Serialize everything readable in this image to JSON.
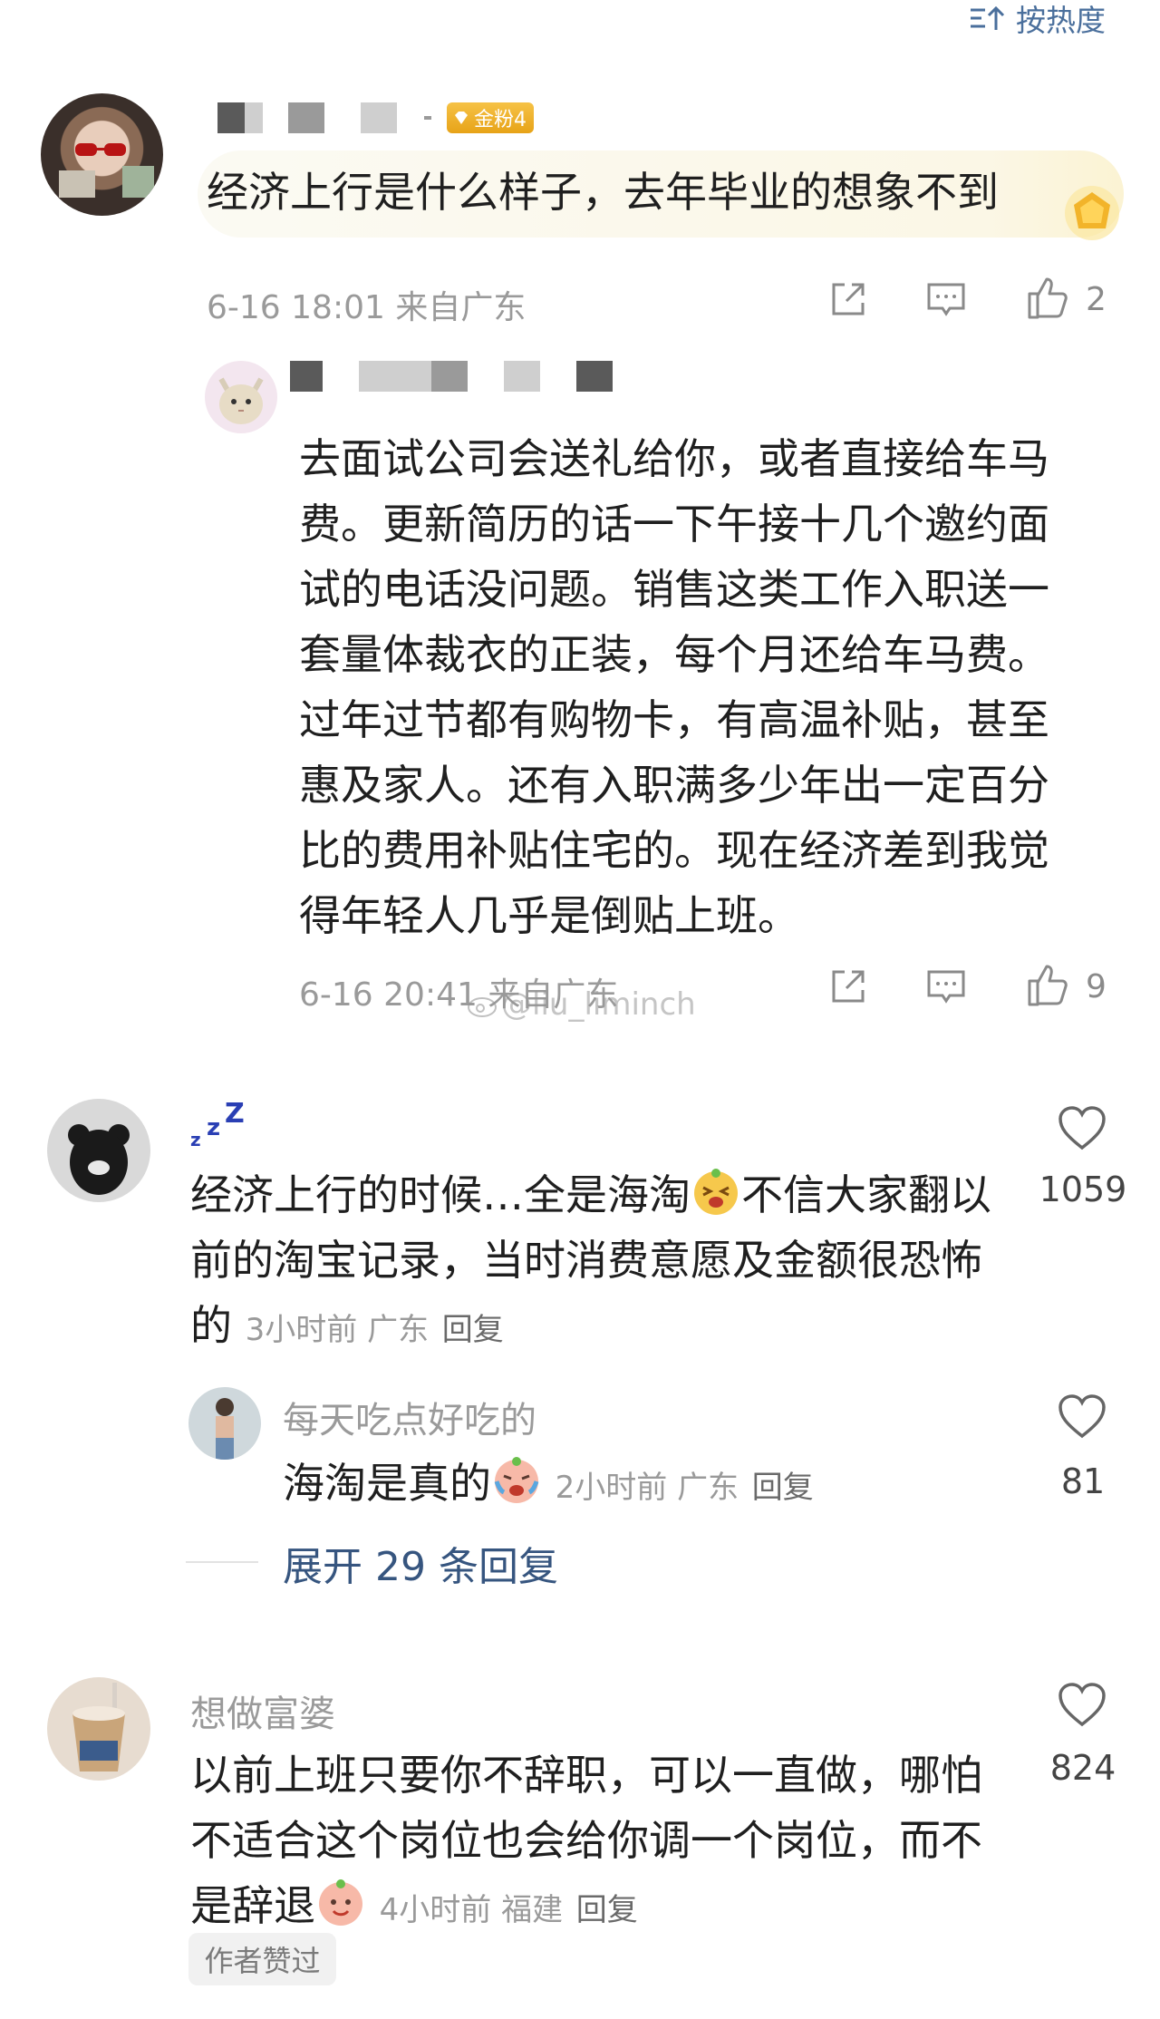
{
  "sort": {
    "label": "按热度"
  },
  "colors": {
    "link": "#36557f",
    "meta": "#9a9a9a",
    "badge": "#f0b22c"
  },
  "comment1": {
    "badge": "金粉4",
    "text": "经济上行是什么样子，去年毕业的想象不到",
    "meta": "6-16 18:01 来自广东",
    "like_count": "2",
    "icons": [
      "share-icon",
      "reply-icon",
      "thumb-up-icon"
    ]
  },
  "reply1": {
    "lines": [
      "去面试公司会送礼给你，或者直接给车马",
      "费。更新简历的话一下午接十几个邀约面",
      "试的电话没问题。销售这类工作入职送一",
      "套量体裁衣的正装，每个月还给车马费。",
      "过年过节都有购物卡，有高温补贴，甚至",
      "惠及家人。还有入职满多少年出一定百分",
      "比的费用补贴住宅的。现在经济差到我觉",
      "得年轻人几乎是倒贴上班。"
    ],
    "meta": "6-16 20:41 来自广东",
    "like_count": "9"
  },
  "watermark": "@liu_liminch",
  "comment2": {
    "name": "zzZ",
    "line1": "经济上行的时候…全是海淘",
    "line1b": "不信大家翻以",
    "line2": "前的淘宝记录，当时消费意愿及金额很恐怖",
    "line3": "的",
    "meta": "3小时前 广东",
    "reply_label": "回复",
    "like_count": "1059"
  },
  "subreply": {
    "name": "每天吃点好吃的",
    "text": "海淘是真的",
    "meta": "2小时前 广东",
    "reply_label": "回复",
    "like_count": "81"
  },
  "expand": {
    "label": "展开 29 条回复"
  },
  "comment3": {
    "name": "想做富婆",
    "line1": "以前上班只要你不辞职，可以一直做，哪怕",
    "line2": "不适合这个岗位也会给你调一个岗位，而不",
    "line3": "是辞退",
    "meta": "4小时前 福建",
    "reply_label": "回复",
    "like_count": "824",
    "author_tag": "作者赞过"
  }
}
